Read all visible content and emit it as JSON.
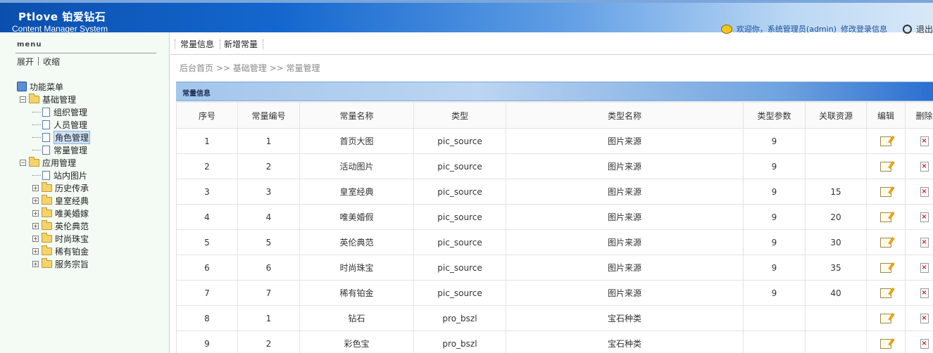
{
  "header": {
    "title": "Ptlove 铂爱钻石",
    "subtitle": "Content Manager System",
    "welcome": "欢迎你，系统管理员(admin)",
    "edit_login": "修改登录信息",
    "logout": "退出",
    "welcome_icon": "smiley-icon",
    "logout_icon": "power-icon"
  },
  "sidebar": {
    "menu_label": "menu",
    "expand": "展开",
    "collapse": "收缩",
    "root": "功能菜单",
    "groups": [
      {
        "label": "基础管理",
        "toggle": "−",
        "items": [
          "组织管理",
          "人员管理",
          "角色管理",
          "常量管理"
        ]
      },
      {
        "label": "应用管理",
        "toggle": "−",
        "items": [
          "站内图片",
          "历史传承",
          "皇室经典",
          "唯美婚嫁",
          "英伦典范",
          "时尚珠宝",
          "稀有铂金",
          "服务宗旨"
        ]
      }
    ],
    "selected": "角色管理"
  },
  "tabs": [
    "常量信息",
    "新增常量"
  ],
  "breadcrumb": "后台首页 >> 基础管理 >> 常量管理",
  "panel_title": "常量信息",
  "table": {
    "headers": [
      "序号",
      "常量编号",
      "常量名称",
      "类型",
      "类型名称",
      "类型参数",
      "关联资源",
      "编辑",
      "删除"
    ],
    "rows": [
      [
        "1",
        "1",
        "首页大图",
        "pic_source",
        "图片来源",
        "9",
        ""
      ],
      [
        "2",
        "2",
        "活动图片",
        "pic_source",
        "图片来源",
        "9",
        ""
      ],
      [
        "3",
        "3",
        "皇室经典",
        "pic_source",
        "图片来源",
        "9",
        "15"
      ],
      [
        "4",
        "4",
        "唯美婚假",
        "pic_source",
        "图片来源",
        "9",
        "20"
      ],
      [
        "5",
        "5",
        "英伦典范",
        "pic_source",
        "图片来源",
        "9",
        "30"
      ],
      [
        "6",
        "6",
        "时尚珠宝",
        "pic_source",
        "图片来源",
        "9",
        "35"
      ],
      [
        "7",
        "7",
        "稀有铂金",
        "pic_source",
        "图片来源",
        "9",
        "40"
      ],
      [
        "8",
        "1",
        "钻石",
        "pro_bszl",
        "宝石种类",
        "",
        ""
      ],
      [
        "9",
        "2",
        "彩色宝",
        "pro_bszl",
        "宝石种类",
        "",
        ""
      ]
    ]
  },
  "colors": {
    "header_blue": "#1467cf",
    "sidebar_bg": "#f3fbf4",
    "panel_header": "#a3c6ec"
  }
}
